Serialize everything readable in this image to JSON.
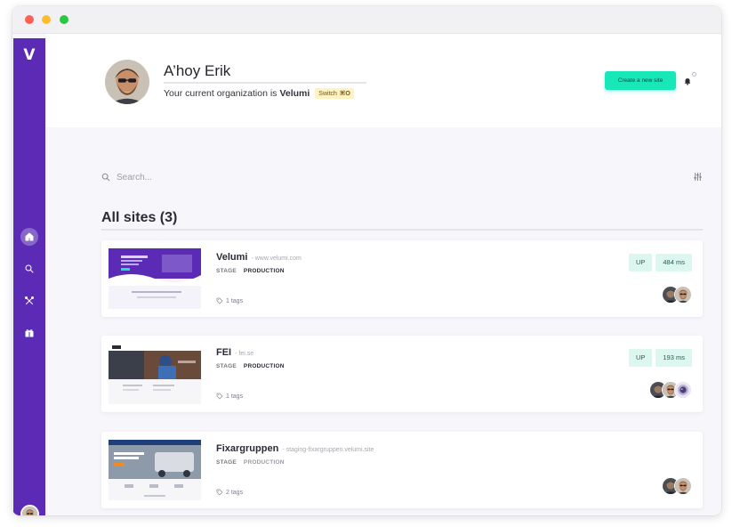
{
  "header": {
    "greeting": "A’hoy Erik",
    "org_prefix": "Your current organization is",
    "org_name": "Velumi",
    "switch_label": "Switch",
    "switch_shortcut": "⌘O",
    "create_button": "Create a new site"
  },
  "sidebar": {
    "logo": "V",
    "items": [
      {
        "name": "home",
        "icon": "home-icon",
        "active": true
      },
      {
        "name": "search",
        "icon": "search-icon",
        "active": false
      },
      {
        "name": "tools",
        "icon": "tools-icon",
        "active": false
      },
      {
        "name": "gift",
        "icon": "gift-icon",
        "active": false
      }
    ]
  },
  "search": {
    "placeholder": "Search..."
  },
  "section": {
    "title": "All sites (3)"
  },
  "sites": [
    {
      "name": "Velumi",
      "url": "- www.velumi.com",
      "stage": "STAGE",
      "production": "PRODUCTION",
      "tags": "1 tags",
      "status": "UP",
      "response": "484 ms"
    },
    {
      "name": "FEI",
      "url": "- fei.se",
      "stage": "STAGE",
      "production": "PRODUCTION",
      "tags": "1 tags",
      "status": "UP",
      "response": "193 ms"
    },
    {
      "name": "Fixargruppen",
      "url": "- staging-fixargruppen.velumi.site",
      "stage": "STAGE",
      "production": "PRODUCTION",
      "tags": "2 tags"
    }
  ],
  "colors": {
    "sidebar": "#5b2bb6",
    "accent": "#18e8b8",
    "badge_bg": "#dcf7ef"
  }
}
